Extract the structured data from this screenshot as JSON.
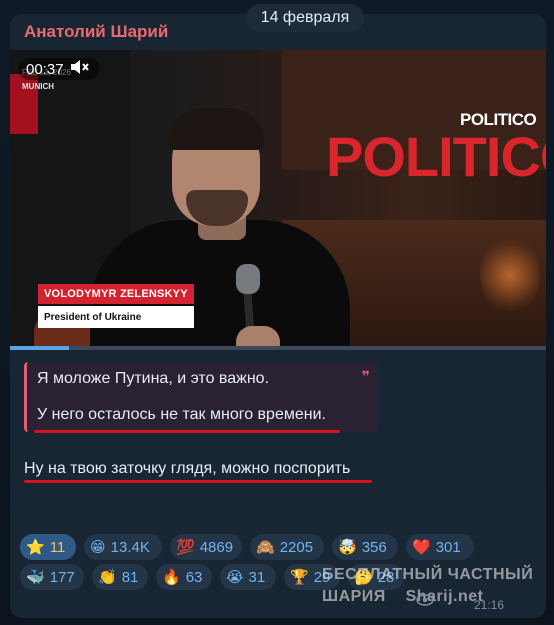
{
  "date_pill": "14 февраля",
  "channel": {
    "name": "Анатолий Шарий"
  },
  "video": {
    "time": "00:37",
    "overlay_date": "FEB 13, 2026",
    "overlay_city": "MUNICH",
    "brand": "POLITICO",
    "backdrop_text": "POLITICO",
    "lower_third_name": "VOLODYMYR ZELENSKYY",
    "lower_third_title": "President of Ukraine",
    "progress": 0.11
  },
  "quote": {
    "line1": "Я моложе Путина, и это важно.",
    "line2": "У него осталось не так много времени."
  },
  "message": {
    "text": "Ну на твою заточку глядя, можно поспорить"
  },
  "reactions": [
    {
      "emoji": "⭐",
      "count": "11"
    },
    {
      "emoji": "😁",
      "count": "13.4K"
    },
    {
      "emoji": "💯",
      "count": "4869"
    },
    {
      "emoji": "🙈",
      "count": "2205"
    },
    {
      "emoji": "🤯",
      "count": "356"
    },
    {
      "emoji": "❤️",
      "count": "301"
    },
    {
      "emoji": "🐳",
      "count": "177"
    },
    {
      "emoji": "👏",
      "count": "81"
    },
    {
      "emoji": "🔥",
      "count": "63"
    },
    {
      "emoji": "😭",
      "count": "31"
    },
    {
      "emoji": "🏆",
      "count": "29"
    },
    {
      "emoji": "🤔",
      "count": "28"
    }
  ],
  "watermark": {
    "line1": "БЕСПЛАТНЫЙ ЧАСТНЫЙ",
    "line2": "ШАРИЯ",
    "site": "Sharij.net"
  },
  "meta": {
    "time": "21:16"
  },
  "colors": {
    "accent": "#ea6a72",
    "bubble": "#182533",
    "reaction_text": "#6fb4f2",
    "underline": "#d5121d"
  }
}
